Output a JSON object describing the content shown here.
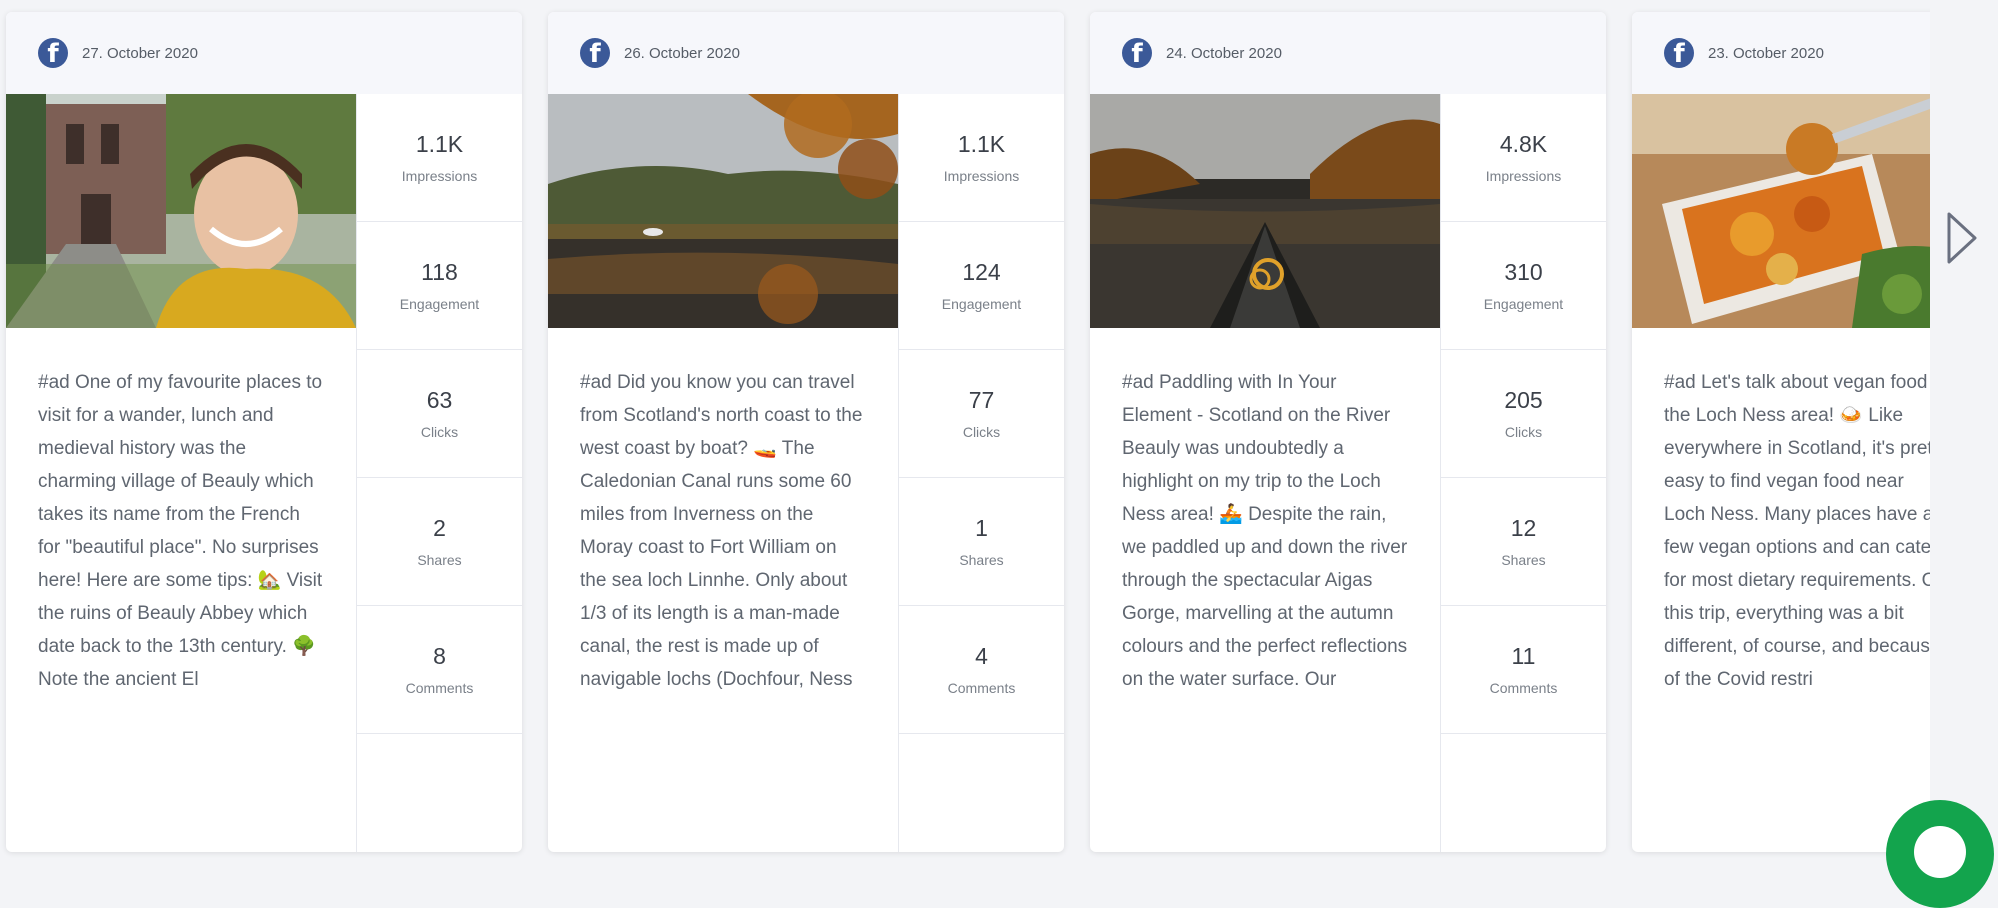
{
  "posts": [
    {
      "date": "27. October 2020",
      "text": "#ad One of my favourite places to visit for a wander, lunch and medieval history was the charming village of Beauly which takes its name from the French for \"beautiful place\". No surprises here! Here are some tips: 🏡 Visit the ruins of Beauly Abbey which date back to the 13th century. 🌳 Note the ancient El",
      "image": "woman-at-abbey-ruins-photo",
      "stats": {
        "impressions": "1.1K",
        "engagement": "118",
        "clicks": "63",
        "shares": "2",
        "comments": "8"
      }
    },
    {
      "date": "26. October 2020",
      "text": "#ad Did you know you can travel from Scotland's north coast to the west coast by boat? 🚤 The Caledonian Canal runs some 60 miles from Inverness on the Moray coast to Fort William on the sea loch Linnhe. Only about 1/3 of its length is a man-made canal, the rest is made up of navigable lochs (Dochfour, Ness",
      "image": "autumn-loch-photo",
      "stats": {
        "impressions": "1.1K",
        "engagement": "124",
        "clicks": "77",
        "shares": "1",
        "comments": "4"
      }
    },
    {
      "date": "24. October 2020",
      "text": "#ad Paddling with In Your Element - Scotland on the River Beauly was undoubtedly a highlight on my trip to the Loch Ness area! 🚣 Despite the rain, we paddled up and down the river through the spectacular Aigas Gorge, marvelling at the autumn colours and the perfect reflections on the water surface. Our",
      "image": "canoe-on-river-photo",
      "stats": {
        "impressions": "4.8K",
        "engagement": "310",
        "clicks": "205",
        "shares": "12",
        "comments": "11"
      }
    },
    {
      "date": "23. October 2020",
      "text": "#ad Let's talk about vegan food in the Loch Ness area! 🍛 Like everywhere in Scotland, it's pretty easy to find vegan food near Loch Ness. Many places have a few vegan options and can cater for most dietary requirements. On this trip, everything was a bit different, of course, and because of the Covid restri",
      "image": "vegan-curry-photo",
      "stats": {
        "impressions": "",
        "engagement": "",
        "clicks": "",
        "shares": "",
        "comments": ""
      }
    }
  ],
  "labels": {
    "impressions": "Impressions",
    "engagement": "Engagement",
    "clicks": "Clicks",
    "shares": "Shares",
    "comments": "Comments"
  },
  "icons": {
    "platform": "facebook-icon",
    "next": "chevron-right-icon",
    "chat": "chat-icon"
  },
  "colors": {
    "facebook": "#3b5998",
    "chat": "#13a44d",
    "card": "#ffffff",
    "header": "#f6f7fb"
  }
}
